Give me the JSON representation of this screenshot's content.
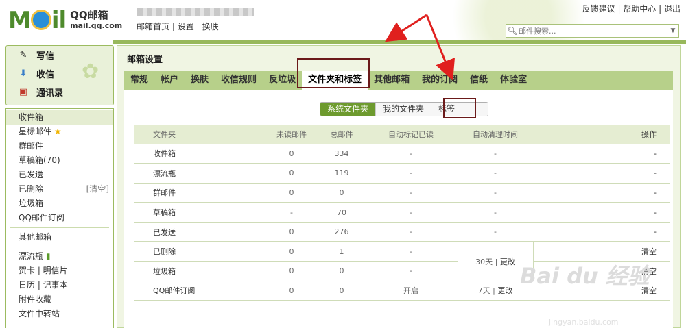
{
  "header": {
    "logo_brand": "MOil",
    "logo_title": "QQ邮箱",
    "logo_domain": "mail.qq.com",
    "nav_links": [
      "邮箱首页",
      "设置",
      "换肤"
    ],
    "top_links": [
      "反馈建议",
      "帮助中心",
      "退出"
    ],
    "search_placeholder": "邮件搜索..."
  },
  "sidebar": {
    "quick_actions": [
      {
        "label": "写信",
        "icon": "pencil-icon"
      },
      {
        "label": "收信",
        "icon": "inbox-download-icon"
      },
      {
        "label": "通讯录",
        "icon": "contacts-icon"
      }
    ],
    "folders": [
      {
        "label": "收件箱",
        "active": true
      },
      {
        "label": "星标邮件",
        "star": true
      },
      {
        "label": "群邮件"
      },
      {
        "label": "草稿箱(70)"
      },
      {
        "label": "已发送"
      },
      {
        "label": "已删除",
        "right": "[清空]"
      },
      {
        "label": "垃圾箱"
      },
      {
        "label": "QQ邮件订阅"
      }
    ],
    "other_folders": [
      {
        "label": "其他邮箱"
      }
    ],
    "tools": [
      {
        "label": "漂流瓶"
      },
      {
        "label": "贺卡 | 明信片"
      },
      {
        "label": "日历 | 记事本"
      },
      {
        "label": "附件收藏"
      },
      {
        "label": "文件中转站"
      }
    ]
  },
  "main": {
    "title": "邮箱设置",
    "tabs": [
      "常规",
      "帐户",
      "换肤",
      "收信规则",
      "反垃圾",
      "文件夹和标签",
      "其他邮箱",
      "我的订阅",
      "信纸",
      "体验室"
    ],
    "active_tab": "文件夹和标签",
    "subtabs": [
      "系统文件夹",
      "我的文件夹",
      "标签"
    ],
    "active_subtab": "系统文件夹",
    "table": {
      "headers": [
        "文件夹",
        "未读邮件",
        "总邮件",
        "自动标记已读",
        "自动清理时间",
        "操作"
      ],
      "rows": [
        {
          "name": "收件箱",
          "unread": "0",
          "total": "334",
          "auto_read": "-",
          "cleanup": "-",
          "op": "-"
        },
        {
          "name": "漂流瓶",
          "unread": "0",
          "total": "119",
          "auto_read": "-",
          "cleanup": "-",
          "op": "-"
        },
        {
          "name": "群邮件",
          "unread": "0",
          "total": "0",
          "auto_read": "-",
          "cleanup": "-",
          "op": "-"
        },
        {
          "name": "草稿箱",
          "unread": "-",
          "total": "70",
          "auto_read": "-",
          "cleanup": "-",
          "op": "-"
        },
        {
          "name": "已发送",
          "unread": "0",
          "total": "276",
          "auto_read": "-",
          "cleanup": "-",
          "op": "-"
        },
        {
          "name": "已删除",
          "unread": "0",
          "total": "1",
          "auto_read": "-",
          "cleanup": "",
          "op": "清空"
        },
        {
          "name": "垃圾箱",
          "unread": "0",
          "total": "0",
          "auto_read": "-",
          "cleanup": "",
          "op": "清空"
        },
        {
          "name": "QQ邮件订阅",
          "unread": "0",
          "total": "0",
          "auto_read": "开启",
          "cleanup": "7天",
          "cleanup_link": "更改",
          "op": "清空"
        }
      ],
      "merged_cleanup_days": "30天",
      "merged_cleanup_link": "更改"
    }
  },
  "watermark": {
    "text": "Bai du 经验",
    "sub": "jingyan.baidu.com"
  },
  "colors": {
    "accent": "#6d9a2e",
    "tab_bar": "#b7d08a",
    "header_bar": "#98b85c",
    "highlight_box": "#6b1a1a",
    "arrow": "#e0201e"
  }
}
